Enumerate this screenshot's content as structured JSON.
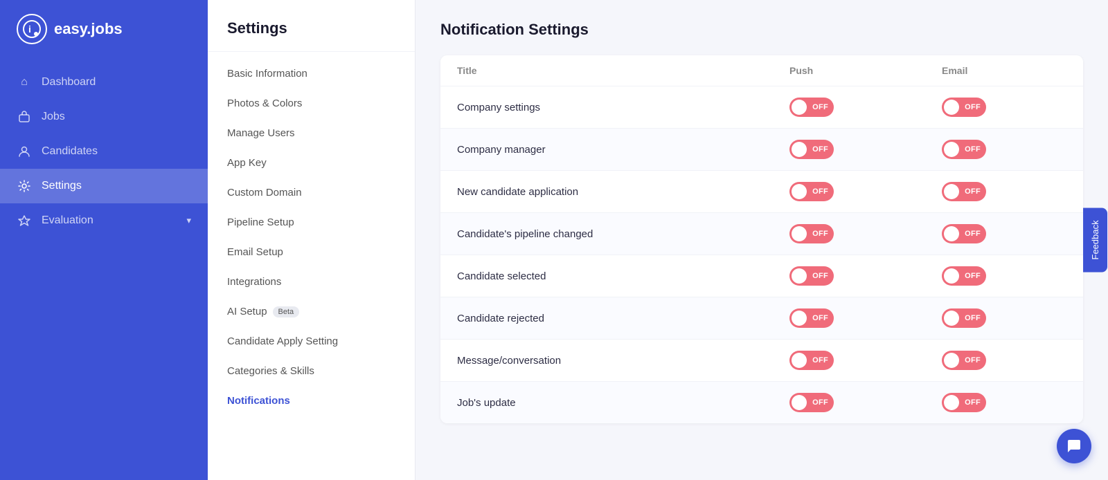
{
  "sidebar": {
    "logo": {
      "icon": "i",
      "text": "easy.jobs"
    },
    "nav_items": [
      {
        "id": "dashboard",
        "label": "Dashboard",
        "icon": "⌂",
        "active": false
      },
      {
        "id": "jobs",
        "label": "Jobs",
        "icon": "💼",
        "active": false
      },
      {
        "id": "candidates",
        "label": "Candidates",
        "icon": "👤",
        "active": false
      },
      {
        "id": "settings",
        "label": "Settings",
        "icon": "⚙",
        "active": true
      },
      {
        "id": "evaluation",
        "label": "Evaluation",
        "icon": "🎓",
        "active": false,
        "has_chevron": true
      }
    ]
  },
  "settings_panel": {
    "title": "Settings",
    "menu_items": [
      {
        "id": "basic-information",
        "label": "Basic Information",
        "active": false
      },
      {
        "id": "photos-colors",
        "label": "Photos & Colors",
        "active": false
      },
      {
        "id": "manage-users",
        "label": "Manage Users",
        "active": false
      },
      {
        "id": "app-key",
        "label": "App Key",
        "active": false
      },
      {
        "id": "custom-domain",
        "label": "Custom Domain",
        "active": false
      },
      {
        "id": "pipeline-setup",
        "label": "Pipeline Setup",
        "active": false
      },
      {
        "id": "email-setup",
        "label": "Email Setup",
        "active": false
      },
      {
        "id": "integrations",
        "label": "Integrations",
        "active": false
      },
      {
        "id": "ai-setup",
        "label": "AI Setup",
        "badge": "Beta",
        "active": false
      },
      {
        "id": "candidate-apply-setting",
        "label": "Candidate Apply Setting",
        "active": false
      },
      {
        "id": "categories-skills",
        "label": "Categories & Skills",
        "active": false
      },
      {
        "id": "notifications",
        "label": "Notifications",
        "active": true
      }
    ]
  },
  "notification_settings": {
    "title": "Notification Settings",
    "table": {
      "headers": {
        "title": "Title",
        "push": "Push",
        "email": "Email"
      },
      "rows": [
        {
          "id": "company-settings",
          "title": "Company settings",
          "push_off": "OFF",
          "email_off": "OFF"
        },
        {
          "id": "company-manager",
          "title": "Company manager",
          "push_off": "OFF",
          "email_off": "OFF"
        },
        {
          "id": "new-candidate-application",
          "title": "New candidate application",
          "push_off": "OFF",
          "email_off": "OFF"
        },
        {
          "id": "candidates-pipeline-changed",
          "title": "Candidate's pipeline changed",
          "push_off": "OFF",
          "email_off": "OFF"
        },
        {
          "id": "candidate-selected",
          "title": "Candidate selected",
          "push_off": "OFF",
          "email_off": "OFF"
        },
        {
          "id": "candidate-rejected",
          "title": "Candidate rejected",
          "push_off": "OFF",
          "email_off": "OFF"
        },
        {
          "id": "message-conversation",
          "title": "Message/conversation",
          "push_off": "OFF",
          "email_off": "OFF"
        },
        {
          "id": "jobs-update",
          "title": "Job's update",
          "push_off": "OFF",
          "email_off": "OFF"
        }
      ]
    }
  },
  "feedback_button": {
    "label": "Feedback"
  },
  "chat_button": {
    "icon": "💬"
  }
}
